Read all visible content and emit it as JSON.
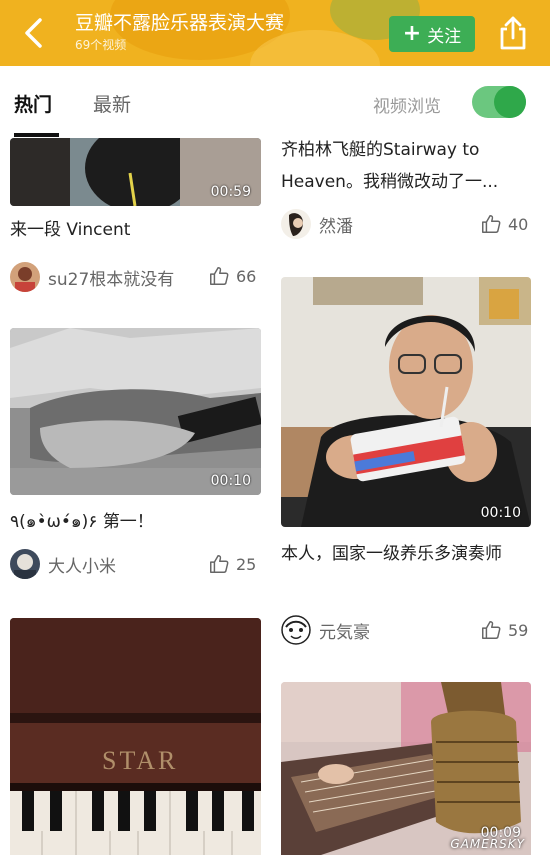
{
  "header": {
    "title": "豆瓣不露脸乐器表演大赛",
    "subtitle": "69个视频",
    "follow_label": "关注",
    "follow_icon": "plus-icon",
    "share_icon": "share-icon",
    "back_icon": "back-icon",
    "accent": "#3dae55",
    "bg": "#f0b21f"
  },
  "tabs": {
    "hot": "热门",
    "new": "最新",
    "toggle_label": "视频浏览",
    "toggle_on": true
  },
  "left_column": [
    {
      "duration": "00:59",
      "caption": "来一段 Vincent",
      "author": "su27根本就没有",
      "likes": "66"
    },
    {
      "duration": "00:10",
      "caption": "٩(๑•̀ω•́๑)۶ 第一！",
      "author": "大人小米",
      "likes": "25"
    },
    {
      "duration": "",
      "caption": "",
      "author": "",
      "likes": "",
      "piano_brand": "STAR"
    }
  ],
  "right_column": [
    {
      "caption": "齐柏林飞艇的Stairway to Heaven。我稍微改动了一...",
      "author": "然潘",
      "likes": "40"
    },
    {
      "duration": "00:10",
      "caption": "本人，国家一级养乐多演奏师",
      "author": "元気豪",
      "likes": "59"
    },
    {
      "duration": "00:09",
      "caption": "",
      "author": "",
      "likes": ""
    }
  ],
  "watermark": "GAMERSKY"
}
